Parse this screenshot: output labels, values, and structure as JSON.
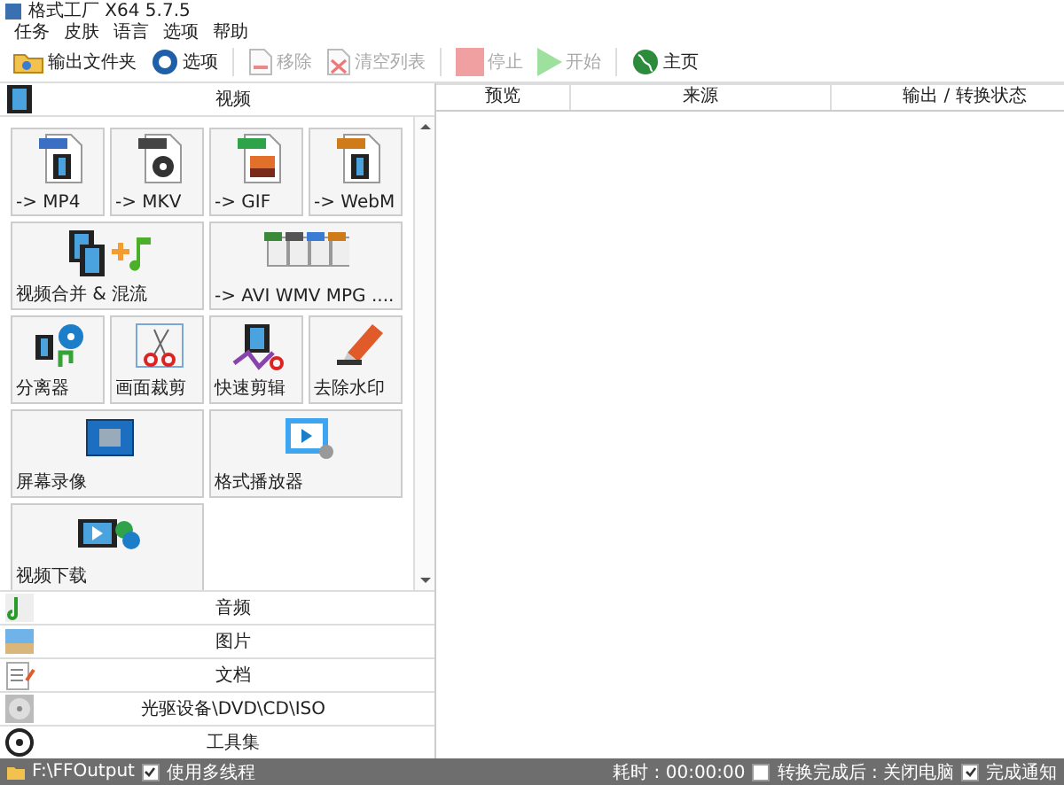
{
  "window": {
    "title": "格式工厂 X64 5.7.5"
  },
  "menu": [
    "任务",
    "皮肤",
    "语言",
    "选项",
    "帮助"
  ],
  "toolbar": [
    {
      "label": "输出文件夹",
      "disabled": false
    },
    {
      "label": "选项",
      "disabled": false
    },
    {
      "label": "移除",
      "disabled": true
    },
    {
      "label": "清空列表",
      "disabled": true
    },
    {
      "label": "停止",
      "disabled": true
    },
    {
      "label": "开始",
      "disabled": true
    },
    {
      "label": "主页",
      "disabled": false
    }
  ],
  "video_panel": {
    "title": "视频",
    "tiles": [
      {
        "label": "-> MP4",
        "wide": false
      },
      {
        "label": "-> MKV",
        "wide": false
      },
      {
        "label": "-> GIF",
        "wide": false
      },
      {
        "label": "-> WebM",
        "wide": false
      },
      {
        "label": "视频合并 & 混流",
        "wide": true
      },
      {
        "label": "-> AVI WMV MPG ....",
        "wide": true
      },
      {
        "label": "分离器",
        "wide": false
      },
      {
        "label": "画面裁剪",
        "wide": false
      },
      {
        "label": "快速剪辑",
        "wide": false
      },
      {
        "label": "去除水印",
        "wide": false
      },
      {
        "label": "屏幕录像",
        "wide": true
      },
      {
        "label": "格式播放器",
        "wide": true
      },
      {
        "label": "视频下载",
        "wide": true
      }
    ]
  },
  "categories": [
    "音频",
    "图片",
    "文档",
    "光驱设备\\DVD\\CD\\ISO",
    "工具集"
  ],
  "table": {
    "columns": [
      "预览",
      "来源",
      "输出 / 转换状态"
    ]
  },
  "status_bar": {
    "folder": "F:\\FFOutput",
    "multithread": {
      "label": "使用多线程",
      "checked": true
    },
    "elapsed": "耗时 : 00:00:00",
    "shutdown": {
      "label": "转换完成后 : 关闭电脑",
      "checked": false
    },
    "notify": {
      "label": "完成通知",
      "checked": true
    }
  }
}
